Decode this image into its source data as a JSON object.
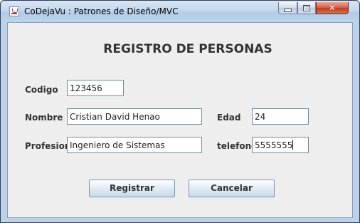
{
  "window": {
    "title": "CoDejaVu : Patrones de Diseño/MVC",
    "controls": {
      "minimize": "minimize",
      "maximize": "maximize",
      "close": "✕"
    }
  },
  "form": {
    "heading": "REGISTRO DE PERSONAS",
    "fields": {
      "codigo": {
        "label": "Codigo",
        "value": "123456"
      },
      "nombre": {
        "label": "Nombre",
        "value": "Cristian David Henao"
      },
      "edad": {
        "label": "Edad",
        "value": "24"
      },
      "profesion": {
        "label": "Profesion",
        "value": "Ingeniero de Sistemas"
      },
      "telefono": {
        "label": "telefono",
        "value": "5555555"
      }
    },
    "buttons": {
      "registrar": "Registrar",
      "cancelar": "Cancelar"
    }
  },
  "colors": {
    "frame": "#bcd2ea",
    "content_bg": "#eeeeee",
    "close_button": "#c0391e"
  }
}
